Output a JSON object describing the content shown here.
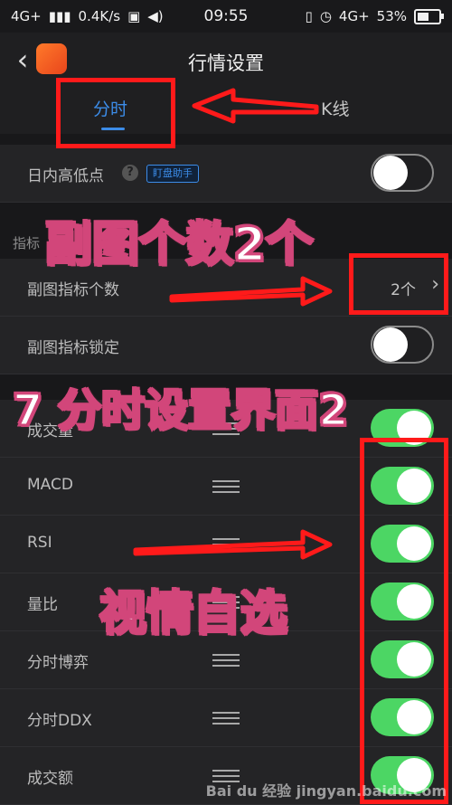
{
  "status": {
    "network": "4G+",
    "speed": "0.4K/s",
    "time": "09:55",
    "network_right": "4G+",
    "battery": "53%"
  },
  "header": {
    "title": "行情设置",
    "back_icon": "chevron-left-icon",
    "logo_icon": "app-logo-icon"
  },
  "tabs": [
    {
      "label": "分时",
      "active": true
    },
    {
      "label": "K线",
      "active": false
    }
  ],
  "settings": {
    "intraday_high_low": {
      "label": "日内高低点",
      "tag": "盯盘助手",
      "help": "?",
      "enabled": false
    },
    "section_indicator": "指标",
    "sub_indicator_count": {
      "label": "副图指标个数",
      "value": "2个"
    },
    "sub_indicator_lock": {
      "label": "副图指标锁定",
      "enabled": false
    }
  },
  "indicators": [
    {
      "label": "成交量",
      "enabled": true
    },
    {
      "label": "MACD",
      "enabled": true
    },
    {
      "label": "RSI",
      "enabled": true
    },
    {
      "label": "量比",
      "enabled": true
    },
    {
      "label": "分时博弈",
      "enabled": true
    },
    {
      "label": "分时DDX",
      "enabled": true
    },
    {
      "label": "成交额",
      "enabled": true
    }
  ],
  "annotations": {
    "caption1": "副图个数2个",
    "caption2": "7 分时设置界面2",
    "caption3": "视情自选",
    "box_color": "#ff1a1a",
    "caption_outline": "#d2467a"
  },
  "watermark": "Bai du 经验  jingyan.baidu.com"
}
